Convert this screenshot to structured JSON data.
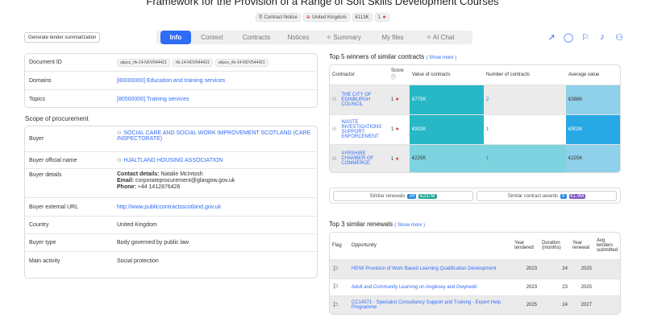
{
  "header": {
    "title": "Framework for the Provision of a Range of Soft Skills Development Courses",
    "badges": [
      {
        "icon": "document-icon",
        "label": "Contract Notice"
      },
      {
        "icon": "flag-uk-icon",
        "label": "United Kingdom"
      },
      {
        "icon": "",
        "label": "€113K"
      },
      {
        "icon": "star-icon",
        "label": "1"
      }
    ]
  },
  "toolbar": {
    "generate_label": "Generate tender summarization",
    "tabs": [
      "Info",
      "Context",
      "Contracts",
      "Notices",
      "Summary",
      "My files",
      "AI Chat"
    ],
    "active_tab": "Info"
  },
  "details": {
    "document_id_label": "Document ID",
    "document_ids": [
      "ukpcs_rfs-14-NOV544421",
      "rfs-14-NOV544421",
      "ukpcs_rfs-14-NOV544421"
    ],
    "domains_label": "Domains",
    "domains_value": "[80000000] Education and training services",
    "topics_label": "Topics",
    "topics_value": "[80500000] Training services"
  },
  "procurement": {
    "section_title": "Scope of procurement",
    "buyer_label": "Buyer",
    "buyer_value": "SOCIAL CARE AND SOCIAL WORK IMPROVEMENT SCOTLAND (CARE INSPECTORATE)",
    "buyer_official_label": "Buyer official name",
    "buyer_official_value": "HJALTLAND HOUSING ASSOCIATION",
    "buyer_details_label": "Buyer details",
    "contact_key": "Contact details:",
    "contact_val": "Natalie McIntosh",
    "email_key": "Email:",
    "email_val": "corporateprocurement@glasgow.gov.uk",
    "phone_key": "Phone:",
    "phone_val": "+44 1412876426",
    "url_label": "Buyer external URL",
    "url_value": "http://www.publiccontractsscotland.gov.uk",
    "country_label": "Country",
    "country_value": "United Kingdom",
    "type_label": "Buyer type",
    "type_value": "Body governed by public law",
    "activity_label": "Main activity",
    "activity_value": "Social protection"
  },
  "winners": {
    "title": "Top 5 winners of similar contracts",
    "show_more": "( Show more )",
    "headers": [
      "Contractor",
      "Score",
      "Value of contracts",
      "Number of contracts",
      "Average value"
    ],
    "rows": [
      {
        "name": "THE CITY OF EDINBURGH COUNCIL",
        "score": "1",
        "value": "€775K",
        "count": "2",
        "avg": "€388K"
      },
      {
        "name": "WASTE INVESTIGATIONS SUPPORT ENFORCEMENT",
        "score": "1",
        "value": "€902K",
        "count": "1",
        "avg": "€902K"
      },
      {
        "name": "AYRSHIRE CHAMBER OF COMMERCE",
        "score": "1",
        "value": "€225K",
        "count": "1",
        "avg": "€225K"
      }
    ]
  },
  "similar": {
    "renewals_label": "Similar renewals",
    "renewals_count": "34",
    "renewals_value": "€237M",
    "awards_label": "Similar contract awards",
    "awards_count": "8",
    "awards_value": "€1.9M"
  },
  "renewals": {
    "title": "Top 3 similar renewals",
    "show_more": "( Show more )",
    "headers": [
      "Flag",
      "Opportunity",
      "Year tendered",
      "Duration (months)",
      "Year renewal",
      "Avg tenders submitted"
    ],
    "rows": [
      {
        "opp": "HEIW Provision of Work Based Learning Qualification Development",
        "year": "2023",
        "dur": "24",
        "renew": "2025",
        "avg": ""
      },
      {
        "opp": "Adult and Community Learning on Anglesey and Gwynedd",
        "year": "2023",
        "dur": "23",
        "renew": "2025",
        "avg": ""
      },
      {
        "opp": "CC14371 - Specialist Consultancy Support and Training - Expert Help Programme",
        "year": "2025",
        "dur": "24",
        "renew": "2027",
        "avg": ""
      }
    ]
  },
  "colors": {
    "accent": "#2f6cf6",
    "teal_dark": "#27b7c5",
    "teal_light": "#7dd3df",
    "blue_bright": "#29a8e6",
    "blue_light": "#8fd0ea"
  }
}
